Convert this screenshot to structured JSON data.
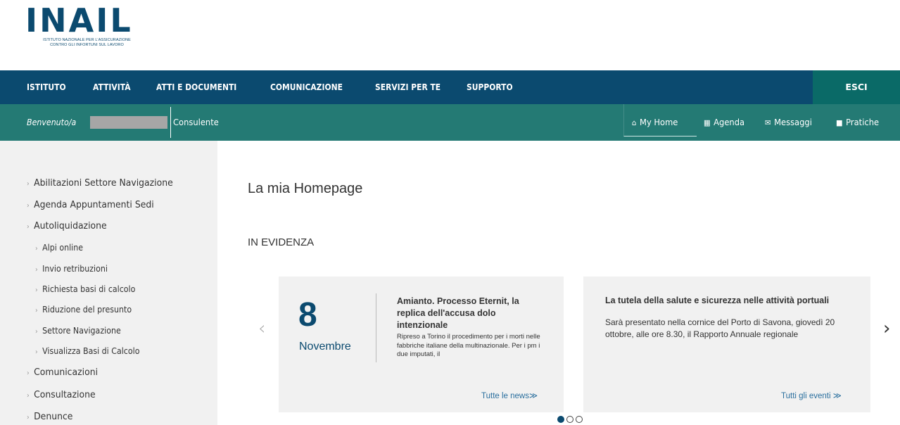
{
  "logo": {
    "word": "INAIL",
    "subtitle_line1": "ISTITUTO NAZIONALE PER L'ASSICURAZIONE",
    "subtitle_line2": "CONTRO GLI INFORTUNI SUL LAVORO"
  },
  "main_nav": {
    "items": [
      "ISTITUTO",
      "ATTIVITÀ",
      "ATTI E DOCUMENTI",
      "COMUNICAZIONE",
      "SERVIZI PER TE",
      "SUPPORTO"
    ],
    "logout": "ESCI"
  },
  "sub_bar": {
    "welcome": "Benvenuto/a",
    "role": "Consulente",
    "links": [
      {
        "icon": "home-icon",
        "label": "My Home"
      },
      {
        "icon": "calendar-icon",
        "label": "Agenda"
      },
      {
        "icon": "mail-icon",
        "label": "Messaggi"
      },
      {
        "icon": "folder-icon",
        "label": "Pratiche"
      }
    ]
  },
  "sidebar": {
    "items": [
      {
        "label": "Abilitazioni Settore Navigazione",
        "level": 1
      },
      {
        "label": "Agenda Appuntamenti Sedi",
        "level": 1
      },
      {
        "label": "Autoliquidazione",
        "level": 1
      },
      {
        "label": "Alpi online",
        "level": 2
      },
      {
        "label": "Invio retribuzioni",
        "level": 2
      },
      {
        "label": "Richiesta basi di calcolo",
        "level": 2
      },
      {
        "label": "Riduzione del presunto",
        "level": 2
      },
      {
        "label": "Settore Navigazione",
        "level": 2
      },
      {
        "label": "Visualizza Basi di Calcolo",
        "level": 2
      },
      {
        "label": "Comunicazioni",
        "level": 1
      },
      {
        "label": "Consultazione",
        "level": 1
      },
      {
        "label": "Denunce",
        "level": 1
      }
    ]
  },
  "main": {
    "title": "La mia Homepage",
    "section": "IN EVIDENZA",
    "news": {
      "day": "8",
      "month": "Novembre",
      "title": "Amianto. Processo Eternit, la replica dell'accusa dolo intenzionale",
      "body": "Ripreso a Torino il procedimento per i morti nelle fabbriche italiane della multinazionale. Per i pm i due imputati, il",
      "link": "Tutte le news≫"
    },
    "event": {
      "title": "La tutela della salute e sicurezza nelle attività portuali",
      "body": "Sarà presentato nella cornice del Porto di Savona, giovedì 20 ottobre, alle ore 8.30, il Rapporto Annuale regionale",
      "link": "Tutti gli eventi ≫"
    },
    "carousel": {
      "prev": "‹",
      "next": "›",
      "active_slide": 1,
      "slide_count": 3
    }
  },
  "colors": {
    "nav_bg": "#0b4a6f",
    "subbar_bg": "#247a74",
    "logout_bg": "#0a6a67",
    "sidebar_bg": "#f1f1f1",
    "card_bg": "#f1f1f1",
    "link": "#2a6f9e"
  }
}
